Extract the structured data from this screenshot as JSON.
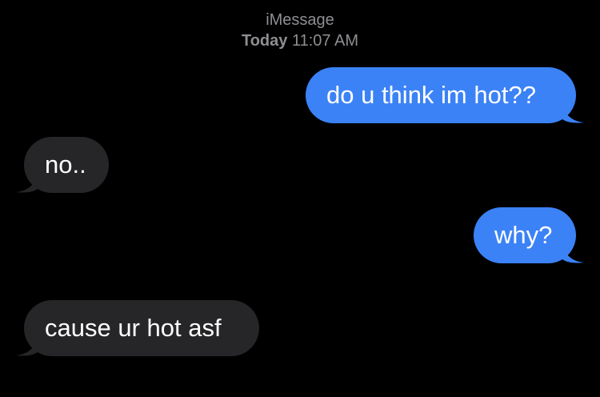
{
  "header": {
    "service": "iMessage",
    "day": "Today",
    "time": "11:07 AM"
  },
  "messages": [
    {
      "direction": "sent",
      "text": "do u think im hot??"
    },
    {
      "direction": "received",
      "text": "no.."
    },
    {
      "direction": "sent",
      "text": "why?"
    },
    {
      "direction": "received",
      "text": "cause ur hot asf"
    }
  ],
  "colors": {
    "sent_bubble": "#3b82f6",
    "received_bubble": "#262628",
    "background": "#000000",
    "meta_text": "#8e8e93"
  }
}
